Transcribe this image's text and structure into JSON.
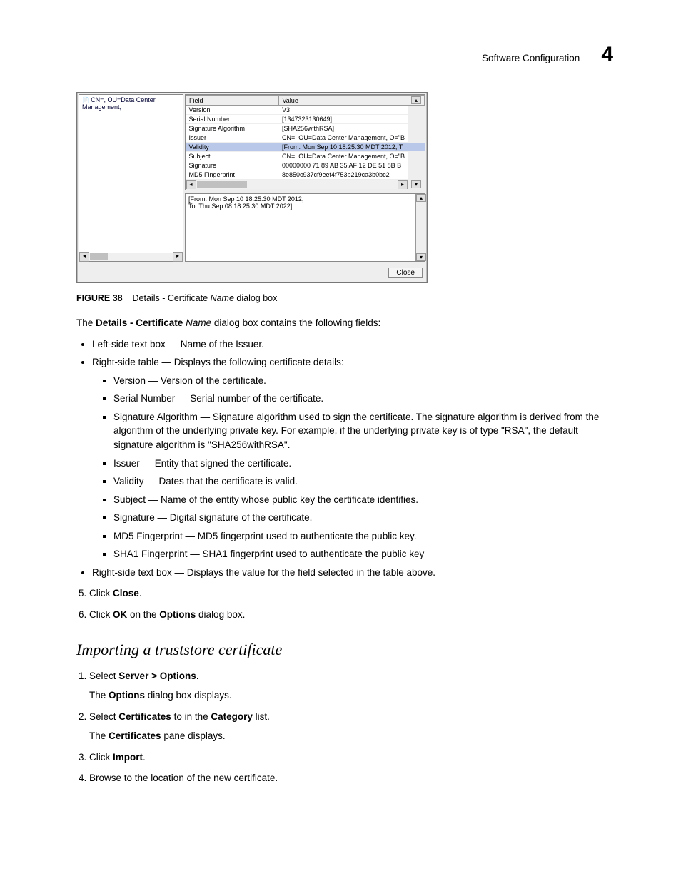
{
  "header": {
    "title": "Software Configuration",
    "chapter": "4"
  },
  "dialog": {
    "tree_item": "CN=, OU=Data Center Management,",
    "columns": {
      "field": "Field",
      "value": "Value"
    },
    "rows": [
      {
        "field": "Version",
        "value": "V3"
      },
      {
        "field": "Serial Number",
        "value": "[1347323130649]"
      },
      {
        "field": "Signature Algorithm",
        "value": "[SHA256withRSA]"
      },
      {
        "field": "Issuer",
        "value": "CN=, OU=Data Center Management, O=\"B"
      },
      {
        "field": "Validity",
        "value": "[From: Mon Sep 10 18:25:30 MDT 2012, T",
        "selected": true
      },
      {
        "field": "Subject",
        "value": "CN=, OU=Data Center Management, O=\"B"
      },
      {
        "field": "Signature",
        "value": "00000000 71 89 AB 35 AF 12 DE 51 8B B"
      },
      {
        "field": "MD5 Fingerprint",
        "value": "8e850c937cf9eef4f753b219ca3b0bc2"
      }
    ],
    "detail_line1": "[From: Mon Sep 10 18:25:30 MDT 2012,",
    "detail_line2": "To: Thu Sep 08 18:25:30 MDT 2022]",
    "close_btn": "Close"
  },
  "figure": {
    "label": "FIGURE 38",
    "text_before": "Details - Certificate ",
    "text_italic": "Name",
    "text_after": " dialog box"
  },
  "intro": {
    "p1a": "The ",
    "p1b": "Details - Certificate",
    "p1c": " ",
    "p1d": "Name",
    "p1e": " dialog box contains the following fields:"
  },
  "bullets": {
    "b1": "Left-side text box — Name of the Issuer.",
    "b2": "Right-side table — Displays the following certificate details:",
    "sub": {
      "s1": "Version — Version of the certificate.",
      "s2": "Serial Number — Serial number of the certificate.",
      "s3": "Signature Algorithm — Signature algorithm used to sign the certificate. The signature algorithm is derived from the algorithm of the underlying private key. For example, if the underlying private key is of type \"RSA\", the default signature algorithm is \"SHA256withRSA\".",
      "s4": "Issuer — Entity that signed the certificate.",
      "s5": "Validity — Dates that the certificate is valid.",
      "s6": "Subject — Name of the entity whose public key the certificate identifies.",
      "s7": "Signature — Digital signature of the certificate.",
      "s8": "MD5 Fingerprint — MD5 fingerprint used to authenticate the public key.",
      "s9": "SHA1 Fingerprint — SHA1 fingerprint used to authenticate the public key"
    },
    "b3": "Right-side text box — Displays the value for the field selected in the table above."
  },
  "steps1": {
    "s5a": "Click ",
    "s5b": "Close",
    "s5c": ".",
    "s6a": "Click ",
    "s6b": "OK",
    "s6c": " on the ",
    "s6d": "Options",
    "s6e": " dialog box."
  },
  "section_h": "Importing a truststore certificate",
  "steps2": {
    "s1a": "Select ",
    "s1b": "Server > Options",
    "s1c": ".",
    "s1fa": "The ",
    "s1fb": "Options",
    "s1fc": " dialog box displays.",
    "s2a": "Select ",
    "s2b": "Certificates",
    "s2c": " to in the ",
    "s2d": "Category",
    "s2e": " list.",
    "s2fa": "The ",
    "s2fb": "Certificates",
    "s2fc": " pane displays.",
    "s3a": "Click ",
    "s3b": "Import",
    "s3c": ".",
    "s4": "Browse to the location of the new certificate."
  }
}
